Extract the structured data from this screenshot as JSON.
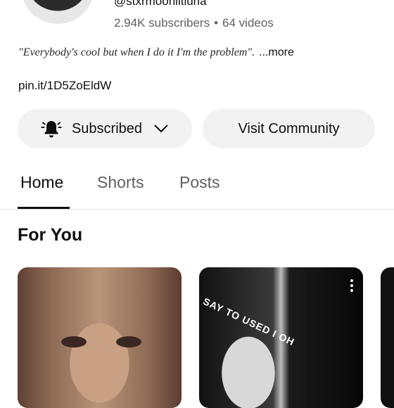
{
  "channel": {
    "handle": "@stxrmoonlitluna",
    "subscribers": "2.94K subscribers",
    "separator": "•",
    "videos": "64 videos",
    "description": "\"Everybody's cool but when I do it I'm the problem\".",
    "more_label": "...more",
    "link": "pin.it/1D5ZoEldW"
  },
  "actions": {
    "subscribed_label": "Subscribed",
    "community_label": "Visit Community"
  },
  "tabs": [
    {
      "label": "Home",
      "selected": true
    },
    {
      "label": "Shorts",
      "selected": false
    },
    {
      "label": "Posts",
      "selected": false
    }
  ],
  "section": {
    "title": "For You"
  },
  "cards": [
    {
      "overlay_text": ""
    },
    {
      "overlay_text": "SAY TO USED I OH"
    }
  ],
  "icons": {
    "bell": "bell-icon",
    "chevron": "chevron-down-icon",
    "kebab": "more-vert-icon"
  },
  "colors": {
    "text": "#0f0f0f",
    "secondary_text": "#606060",
    "button_bg": "#f2f2f2"
  }
}
